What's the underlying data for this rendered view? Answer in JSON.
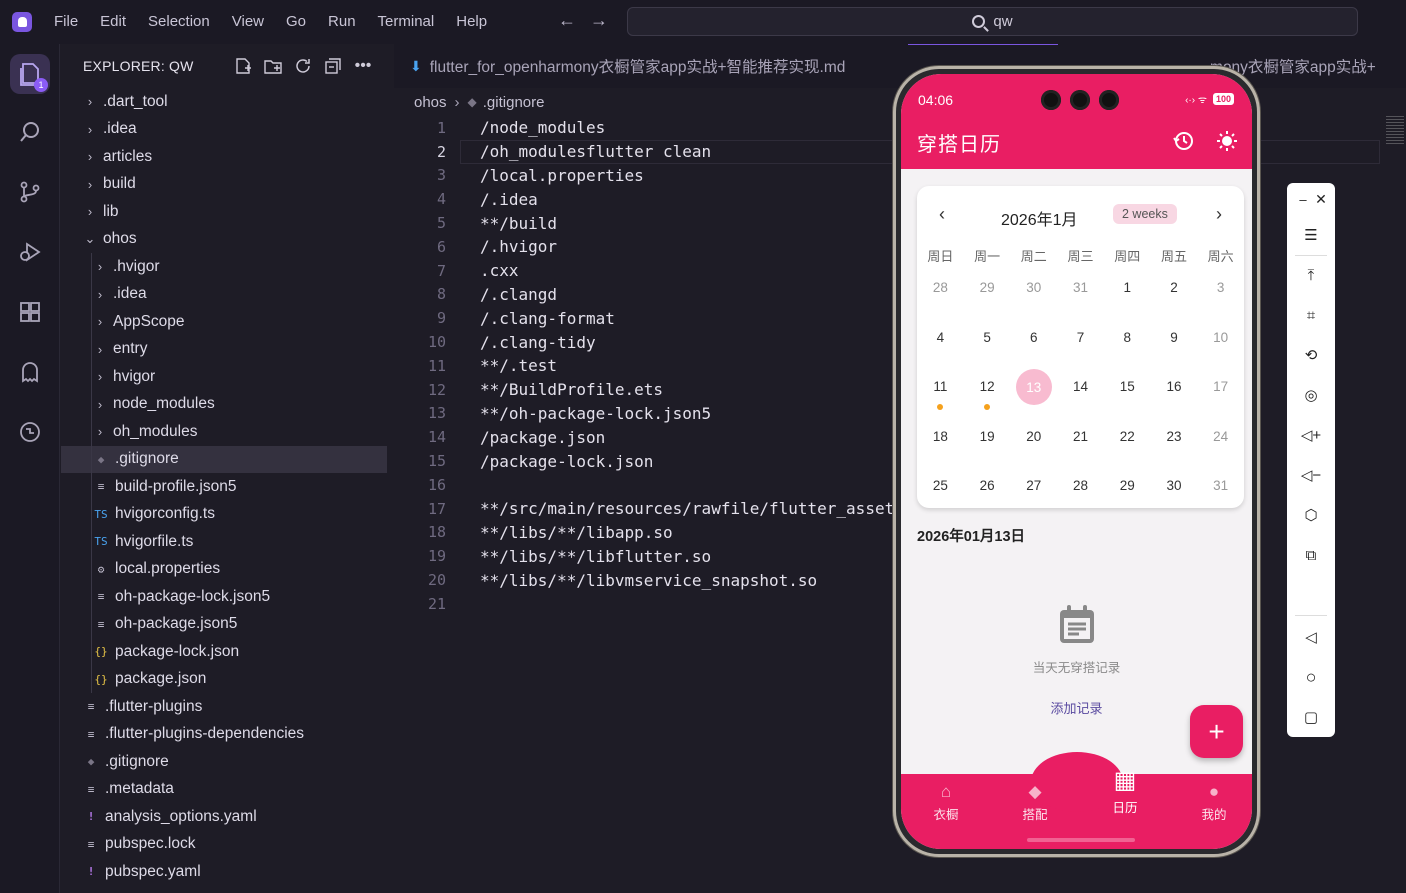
{
  "menu": [
    "File",
    "Edit",
    "Selection",
    "View",
    "Go",
    "Run",
    "Terminal",
    "Help"
  ],
  "search": {
    "text": "qw"
  },
  "activity": {
    "badge": "1"
  },
  "explorer": {
    "title": "EXPLORER: QW",
    "items": [
      {
        "label": ".dart_tool",
        "type": "folder",
        "depth": 0,
        "open": false
      },
      {
        "label": ".idea",
        "type": "folder",
        "depth": 0,
        "open": false
      },
      {
        "label": "articles",
        "type": "folder",
        "depth": 0,
        "open": false
      },
      {
        "label": "build",
        "type": "folder",
        "depth": 0,
        "open": false
      },
      {
        "label": "lib",
        "type": "folder",
        "depth": 0,
        "open": false
      },
      {
        "label": "ohos",
        "type": "folder",
        "depth": 0,
        "open": true
      },
      {
        "label": ".hvigor",
        "type": "folder",
        "depth": 1,
        "open": false
      },
      {
        "label": ".idea",
        "type": "folder",
        "depth": 1,
        "open": false
      },
      {
        "label": "AppScope",
        "type": "folder",
        "depth": 1,
        "open": false
      },
      {
        "label": "entry",
        "type": "folder",
        "depth": 1,
        "open": false
      },
      {
        "label": "hvigor",
        "type": "folder",
        "depth": 1,
        "open": false
      },
      {
        "label": "node_modules",
        "type": "folder",
        "depth": 1,
        "open": false
      },
      {
        "label": "oh_modules",
        "type": "folder",
        "depth": 1,
        "open": false
      },
      {
        "label": ".gitignore",
        "type": "git",
        "depth": 1,
        "selected": true
      },
      {
        "label": "build-profile.json5",
        "type": "lines",
        "depth": 1
      },
      {
        "label": "hvigorconfig.ts",
        "type": "ts",
        "depth": 1
      },
      {
        "label": "hvigorfile.ts",
        "type": "ts",
        "depth": 1
      },
      {
        "label": "local.properties",
        "type": "gear",
        "depth": 1
      },
      {
        "label": "oh-package-lock.json5",
        "type": "lines",
        "depth": 1
      },
      {
        "label": "oh-package.json5",
        "type": "lines",
        "depth": 1
      },
      {
        "label": "package-lock.json",
        "type": "json",
        "depth": 1
      },
      {
        "label": "package.json",
        "type": "json",
        "depth": 1
      },
      {
        "label": ".flutter-plugins",
        "type": "lines",
        "depth": 0
      },
      {
        "label": ".flutter-plugins-dependencies",
        "type": "lines",
        "depth": 0
      },
      {
        "label": ".gitignore",
        "type": "git",
        "depth": 0
      },
      {
        "label": ".metadata",
        "type": "lines",
        "depth": 0
      },
      {
        "label": "analysis_options.yaml",
        "type": "yaml",
        "depth": 0
      },
      {
        "label": "pubspec.lock",
        "type": "lines",
        "depth": 0
      },
      {
        "label": "pubspec.yaml",
        "type": "yaml",
        "depth": 0
      }
    ]
  },
  "tabs": {
    "tab1": "flutter_for_openharmony衣橱管家app实战+智能推荐实现.md",
    "tab3": "mony衣橱管家app实战+"
  },
  "breadcrumb": {
    "folder": "ohos",
    "file": ".gitignore"
  },
  "code": {
    "current_line": 2,
    "lines": [
      "/node_modules",
      "/oh_modulesflutter clean",
      "/local.properties",
      "/.idea",
      "**/build",
      "/.hvigor",
      ".cxx",
      "/.clangd",
      "/.clang-format",
      "/.clang-tidy",
      "**/.test",
      "**/BuildProfile.ets",
      "**/oh-package-lock.json5",
      "/package.json",
      "/package-lock.json",
      "",
      "**/src/main/resources/rawfile/flutter_asset",
      "**/libs/**/libapp.so",
      "**/libs/**/libflutter.so",
      "**/libs/**/libvmservice_snapshot.so",
      ""
    ]
  },
  "phone": {
    "status_time": "04:06",
    "battery": "100",
    "app_title": "穿搭日历",
    "calendar": {
      "month": "2026年1月",
      "format_chip": "2 weeks",
      "weekdays": [
        "周日",
        "周一",
        "周二",
        "周三",
        "周四",
        "周五",
        "周六"
      ],
      "weeks": [
        [
          "28",
          "29",
          "30",
          "31",
          "1",
          "2",
          "3"
        ],
        [
          "4",
          "5",
          "6",
          "7",
          "8",
          "9",
          "10"
        ],
        [
          "11",
          "12",
          "13",
          "14",
          "15",
          "16",
          "17"
        ],
        [
          "18",
          "19",
          "20",
          "21",
          "22",
          "23",
          "24"
        ],
        [
          "25",
          "26",
          "27",
          "28",
          "29",
          "30",
          "31"
        ]
      ],
      "muted_first_row": 4,
      "today": "13",
      "marked_days": [
        "11",
        "12"
      ]
    },
    "selected_date": "2026年01月13日",
    "empty_text": "当天无穿搭记录",
    "add_record": "添加记录",
    "nav": [
      "衣橱",
      "搭配",
      "日历",
      "我的"
    ],
    "active_nav": 2,
    "accent_color": "#e91e63"
  }
}
